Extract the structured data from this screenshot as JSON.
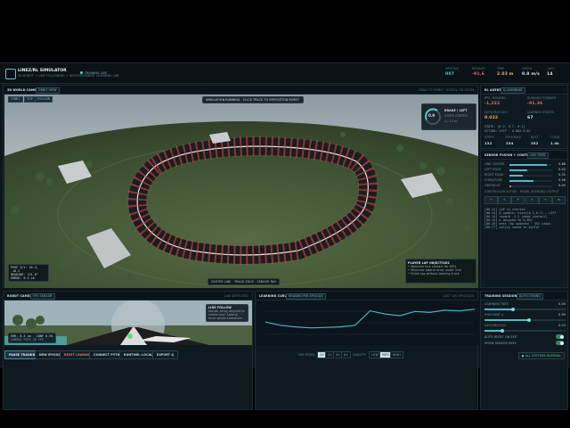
{
  "app": {
    "title": "LINEZ/RL SIMULATOR",
    "subtitle": "3D ROBOT + LINE FOLLOWING + REINFORCEMENT LEARNING LAB",
    "status": "TRAINING LIVE",
    "metrics": [
      {
        "label": "EPISODE",
        "value": "007",
        "color": "#4fc6d2"
      },
      {
        "label": "REWARD",
        "value": "-91.6",
        "color": "#e06b6b"
      },
      {
        "label": "TIME",
        "value": "2.03 m",
        "color": "#e8b45a"
      },
      {
        "label": "SPEED",
        "value": "0.8 m/s",
        "color": "#d9e8ec"
      },
      {
        "label": "LAPS",
        "value": "14",
        "color": "#d9e8ec"
      }
    ]
  },
  "world": {
    "title": "3D WORLD CAMERA",
    "tag": "ORBIT VIEW",
    "right_info": "DRAG TO ORBIT · SCROLL TO ZOOM",
    "view_buttons": [
      "ORBIT",
      "TOP",
      "FOLLOW"
    ],
    "hint": "SIMULATION RUNNING · CLICK TRACK TO REPOSITION ROBOT",
    "speed_gauge": {
      "value": "0.9",
      "unit": "m/s",
      "label": "BRAKE / LEFT",
      "detail": "STEER CENTER",
      "extra": "4 / 12 m"
    },
    "telemetry": [
      "POSE X/Y: 45.4, -10.2",
      "HEADING: 121.6°",
      "ERROR: 0.3 cm"
    ],
    "legend": [
      "CENTER LINE",
      "TRACK EDGE",
      "SENSOR RAY"
    ],
    "objectives_title": "PLAYER LAP OBJECTIVES",
    "objectives": [
      "• Maintain line contact for 80%",
      "• Minimize lateral error under 2cm",
      "• Finish lap without leaving track"
    ]
  },
  "agent": {
    "title": "RL AGENT",
    "tag": "Q-LEARNING",
    "stats": [
      {
        "label": "EPS. REWARD",
        "value": "-1,322",
        "color": "#e06b6b"
      },
      {
        "label": "RUNNING REWARD",
        "value": "-91.36",
        "color": "#e06b6b"
      },
      {
        "label": "EXPLORATION ε",
        "value": "0.032",
        "color": "#e8b45a"
      },
      {
        "label": "LEARNED STATES",
        "value": "67",
        "color": "#d9e8ec"
      }
    ],
    "state_line": "STATE: [0.2, 0.7, 0.1]",
    "action_line": "ACTION: LEFT · Q MAX 0.82",
    "counters": [
      {
        "label": "STEPS",
        "value": "132"
      },
      {
        "label": "EPISODES",
        "value": "234"
      },
      {
        "label": "BEST",
        "value": "352"
      },
      {
        "label": "TOTAL",
        "value": "1.4k"
      }
    ]
  },
  "sensor": {
    "title": "SENSOR FUSION + CONTROL",
    "tag": "LIVE FEED",
    "bars": [
      {
        "label": "LINE CENTER",
        "value": "0.88",
        "fill": 0.88
      },
      {
        "label": "LEFT EDGE",
        "value": "0.42",
        "fill": 0.42
      },
      {
        "label": "RIGHT EDGE",
        "value": "0.31",
        "fill": 0.31
      },
      {
        "label": "CURVATURE",
        "value": "0.56",
        "fill": 0.56
      },
      {
        "label": "OBSTACLE",
        "value": "0.05",
        "fill": 0.05
      }
    ],
    "controller": "CONTROLLER ACTIVE · PID/RL BLENDED OUTPUT",
    "actions": [
      "←",
      "↖",
      "↑",
      "↗",
      "→",
      "⟲"
    ],
    "log": [
      "[00:12] LAP 14 started",
      "[00:13] Q-update: state(0.2,0.7) → LEFT",
      "[00:14] reward -1.2 (edge contact)",
      "[00:15] ε decayed to 0.032",
      "[00:16] best lap updated · 352 steps",
      "[00:17] policy saved to buffer"
    ]
  },
  "robot": {
    "title": "ROBOT CAMERA",
    "tag": "FPV SENSOR",
    "right_info": "LINE DETECTED",
    "overlay_title": "LINE FOLLOW",
    "overlay_text": "Sensor array aligned to center line. Lateral error within tolerance.",
    "readout": "ERR: 0.3 cm · CONF 0.94",
    "readout2": "CAMERA FEED 30 FPS"
  },
  "curve": {
    "title": "LEARNING CURVE",
    "tag": "REWARD PER EPISODE",
    "right_info": "LAST 100 EPISODES",
    "series": [
      -0.45,
      -0.55,
      -0.6,
      -0.63,
      -0.62,
      -0.6,
      -0.55,
      -0.1,
      -0.2,
      -0.25,
      -0.12,
      -0.15,
      -0.08,
      -0.1,
      -0.05
    ]
  },
  "session": {
    "title": "TRAINING SESSION",
    "tag": "AUTO-TUNING",
    "sliders": [
      {
        "label": "LEARNING RATE",
        "value": "0.05",
        "fill": 0.35
      },
      {
        "label": "DISCOUNT γ",
        "value": "0.95",
        "fill": 0.55
      },
      {
        "label": "EXPLORATION",
        "value": "0.03",
        "fill": 0.22
      }
    ],
    "toggles": [
      "AUTO-RESET ON EXIT",
      "SHOW SENSOR RAYS"
    ]
  },
  "footer": {
    "buttons": [
      "PAUSE TRAINING",
      "NEW EPISODE",
      "RESET LEARNING",
      "CONNECT PYTHON",
      "RUNTIME: LOCAL JS",
      "EXPORT Q"
    ],
    "speed_label": "SIM SPEED",
    "speed_options": [
      "1×",
      "2×",
      "4×",
      "8×"
    ],
    "quality_label": "QUALITY",
    "quality_options": [
      "LOW",
      "MED",
      "HIGH"
    ],
    "status": "● ALL SYSTEMS NOMINAL"
  }
}
